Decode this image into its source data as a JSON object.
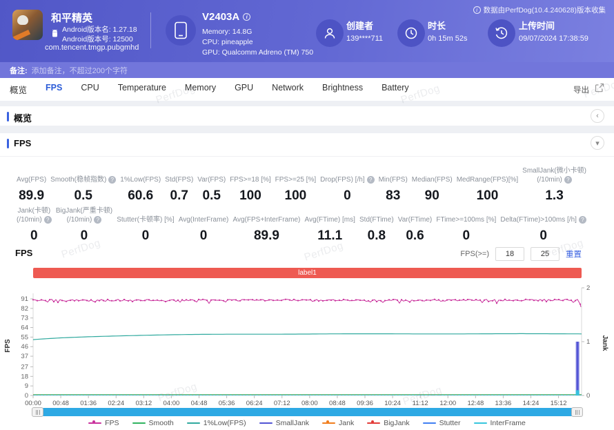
{
  "watermark_text": "PerfDog",
  "header": {
    "collect_info": "数据由PerfDog(10.4.240628)版本收集",
    "app": {
      "name": "和平精英",
      "version_name": "Android版本名: 1.27.18",
      "version_code": "Android版本号: 12500",
      "package": "com.tencent.tmgp.pubgmhd"
    },
    "device": {
      "model": "V2403A",
      "memory": "Memory: 14.8G",
      "cpu": "CPU: pineapple",
      "gpu": "GPU: Qualcomm Adreno (TM) 750"
    },
    "creator": {
      "label": "创建者",
      "value": "139****711"
    },
    "duration": {
      "label": "时长",
      "value": "0h 15m 52s"
    },
    "upload": {
      "label": "上传时间",
      "value": "09/07/2024 17:38:59"
    }
  },
  "note_bar": {
    "label": "备注:",
    "placeholder": "添加备注，不超过200个字符"
  },
  "tab_bar": {
    "tabs": [
      "概览",
      "FPS",
      "CPU",
      "Temperature",
      "Memory",
      "GPU",
      "Network",
      "Brightness",
      "Battery"
    ],
    "active_tab": "FPS",
    "export_label": "导出"
  },
  "overview_section": {
    "title": "概览"
  },
  "fps_section": {
    "title": "FPS",
    "subsection_title": "FPS",
    "filter": {
      "label": "FPS(>=)",
      "value1": "18",
      "value2": "25",
      "reset_label": "重置"
    },
    "stats_row1": [
      {
        "lines": [
          "Avg(FPS)"
        ],
        "info": false,
        "value": "89.9"
      },
      {
        "lines": [
          "Smooth(稳帧指数)"
        ],
        "info": true,
        "value": "0.5"
      },
      {
        "lines": [
          "1%Low(FPS)"
        ],
        "info": false,
        "value": "60.6"
      },
      {
        "lines": [
          "Std(FPS)"
        ],
        "info": false,
        "value": "0.7"
      },
      {
        "lines": [
          "Var(FPS)"
        ],
        "info": false,
        "value": "0.5"
      },
      {
        "lines": [
          "FPS>=18 [%]"
        ],
        "info": false,
        "value": "100"
      },
      {
        "lines": [
          "FPS>=25 [%]"
        ],
        "info": false,
        "value": "100"
      },
      {
        "lines": [
          "Drop(FPS) [/h]"
        ],
        "info": true,
        "value": "0"
      },
      {
        "lines": [
          "Min(FPS)"
        ],
        "info": false,
        "value": "83"
      },
      {
        "lines": [
          "Median(FPS)"
        ],
        "info": false,
        "value": "90"
      },
      {
        "lines": [
          "MedRange(FPS)[%]"
        ],
        "info": false,
        "value": "100"
      },
      {
        "lines": [
          "SmallJank(微小卡顿)",
          "(/10min)"
        ],
        "info": true,
        "value": "1.3"
      }
    ],
    "stats_row2": [
      {
        "lines": [
          "Jank(卡顿)",
          "(/10min)"
        ],
        "info": true,
        "value": "0"
      },
      {
        "lines": [
          "BigJank(严重卡顿)",
          "(/10min)"
        ],
        "info": true,
        "value": "0"
      },
      {
        "lines": [
          "Stutter(卡顿率) [%]"
        ],
        "info": false,
        "value": "0"
      },
      {
        "lines": [
          "Avg(InterFrame)"
        ],
        "info": false,
        "value": "0"
      },
      {
        "lines": [
          "Avg(FPS+InterFrame)"
        ],
        "info": false,
        "value": "89.9"
      },
      {
        "lines": [
          "Avg(FTime) [ms]"
        ],
        "info": false,
        "value": "11.1"
      },
      {
        "lines": [
          "Std(FTime)"
        ],
        "info": false,
        "value": "0.8"
      },
      {
        "lines": [
          "Var(FTime)"
        ],
        "info": false,
        "value": "0.6"
      },
      {
        "lines": [
          "FTime>=100ms [%]"
        ],
        "info": false,
        "value": "0"
      },
      {
        "lines": [
          "Delta(FTime)>100ms [/h]"
        ],
        "info": true,
        "value": "0"
      }
    ]
  },
  "chart_data": {
    "type": "line",
    "title": "FPS over time",
    "region_label": "label1",
    "region_color": "#ee5a52",
    "duration_seconds": 952,
    "x_ticks": [
      "00:00",
      "00:48",
      "01:36",
      "02:24",
      "03:12",
      "04:00",
      "04:48",
      "05:36",
      "06:24",
      "07:12",
      "08:00",
      "08:48",
      "09:36",
      "10:24",
      "11:12",
      "12:00",
      "12:48",
      "13:36",
      "14:24",
      "15:12"
    ],
    "y_left": {
      "label": "FPS",
      "ticks": [
        0,
        9,
        18,
        27,
        37,
        46,
        55,
        64,
        73,
        82,
        91
      ],
      "max": 95
    },
    "y_right": {
      "label": "Jank",
      "ticks": [
        0,
        1,
        2
      ],
      "max": 2
    },
    "series": [
      {
        "name": "FPS",
        "color": "#c9309c",
        "axis": "left",
        "marker": true,
        "shape": "noisy-flat",
        "avg": 89.9,
        "band": [
          87.5,
          91
        ],
        "min": 83,
        "end_dip": 83.3
      },
      {
        "name": "Smooth",
        "color": "#2eb35f",
        "axis": "left",
        "marker": false,
        "shape": "flat",
        "value": 0.5
      },
      {
        "name": "1%Low(FPS)",
        "color": "#2fa99e",
        "axis": "left",
        "marker": false,
        "shape": "rise-flatten",
        "start": 52.5,
        "end": 58.1
      },
      {
        "name": "SmallJank",
        "color": "#5153d4",
        "axis": "right",
        "marker": false,
        "shape": "bar",
        "events": [
          {
            "t": 0.992,
            "value": 1
          }
        ]
      },
      {
        "name": "Jank",
        "color": "#f07d1d",
        "axis": "right",
        "marker": true,
        "shape": "flat-dotted",
        "value": 0
      },
      {
        "name": "BigJank",
        "color": "#e23b38",
        "axis": "right",
        "marker": true,
        "shape": "none",
        "value": 0
      },
      {
        "name": "Stutter",
        "color": "#3f7ef2",
        "axis": "left",
        "marker": false,
        "shape": "none",
        "value": 0
      },
      {
        "name": "InterFrame",
        "color": "#36c6dd",
        "axis": "left",
        "marker": false,
        "shape": "flat",
        "value": 0,
        "events": [
          {
            "t": 0.992,
            "value": 5
          }
        ]
      }
    ]
  }
}
